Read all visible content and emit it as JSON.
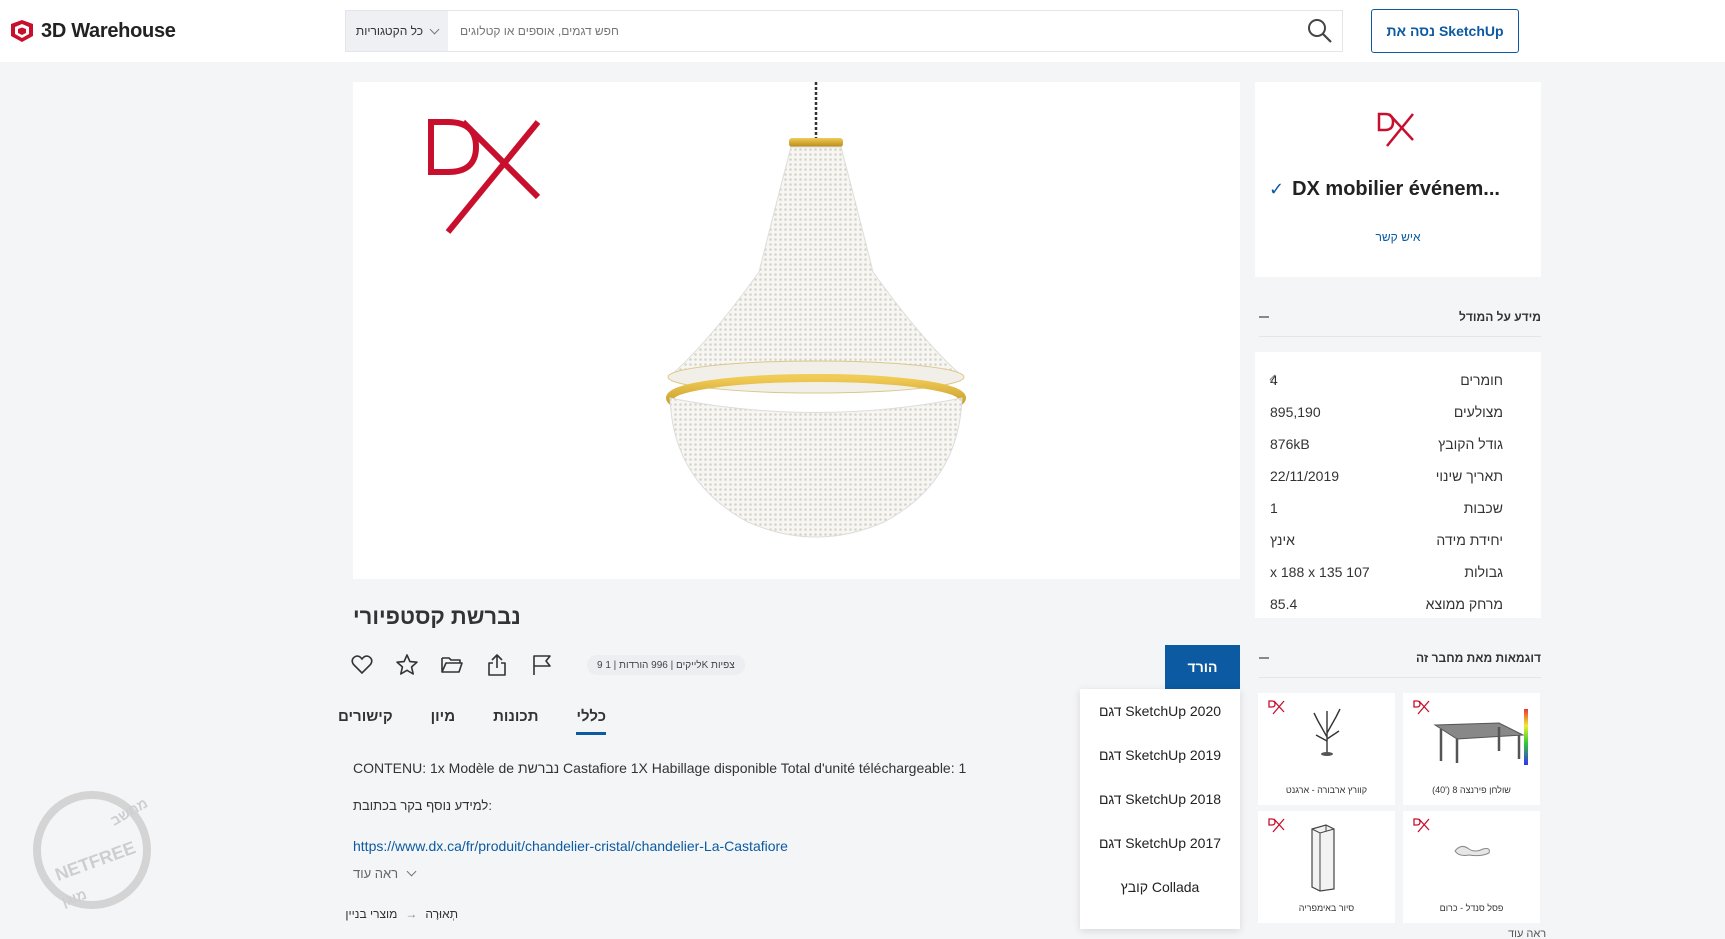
{
  "header": {
    "logo_text": "3D Warehouse",
    "category_label": "כל הקטגוריות",
    "search_placeholder": "חפש דגמים, אוספים או קטלוגים",
    "try_button": "נסה את SketchUp"
  },
  "model": {
    "title": "נברשת קסטפיורי",
    "stats": "צפיות Kלייקים | 996 הורדות | 1 9",
    "download_label": "הורד",
    "download_options": [
      "דגם SketchUp 2020",
      "דגם SketchUp 2019",
      "דגם SketchUp 2018",
      "דגם SketchUp 2017",
      "קובץ Collada"
    ]
  },
  "tabs": [
    "כללי",
    "תכונות",
    "מיון",
    "קישורים"
  ],
  "description": {
    "text": "CONTENU: 1x Modèle de נברשת Castafiore 1X Habillage disponible Total d'unité téléchargeable: 1",
    "info_label": "למידע נוסף בקר בכתובת:",
    "link": "https://www.dx.ca/fr/produit/chandelier-cristal/chandelier-La-Castafiore",
    "see_more": "ראה עוד"
  },
  "breadcrumb": [
    "תְאוּרָה",
    "מוצרי בניין"
  ],
  "author": {
    "name": "DX mobilier événem...",
    "contact": "איש קשר"
  },
  "model_info": {
    "heading": "מידע על המודל",
    "rows": [
      {
        "label": "חומרים",
        "value": "4"
      },
      {
        "label": "מצולעים",
        "value": "895,190"
      },
      {
        "label": "גודל הקובץ",
        "value": "876kB"
      },
      {
        "label": "תאריך שינוי",
        "value": "22/11/2019"
      },
      {
        "label": "שכבות",
        "value": "1"
      },
      {
        "label": "יחידת מידה",
        "value": "אינץ"
      },
      {
        "label": "גבולות",
        "value": "107 x 188 x 135"
      },
      {
        "label": "מרחק ממוצא",
        "value": "85.4"
      }
    ]
  },
  "author_models": {
    "heading": "דוגמאות מאת מחבר זה",
    "items": [
      {
        "caption": "קוורץ ארבורה - ארגנט"
      },
      {
        "caption": "שולחן פירנצה 8 ('40)"
      },
      {
        "caption": "סיור באימפריה"
      },
      {
        "caption": "פסל סנדל - כרום"
      }
    ],
    "see_more": "ראה עוד"
  },
  "watermark": {
    "top": "מחשב",
    "middle": "NETFREE",
    "bottom": "מוגן"
  },
  "colors": {
    "accent": "#0c5aa1",
    "brand_red": "#c8102e",
    "gold": "#d4a82a"
  }
}
